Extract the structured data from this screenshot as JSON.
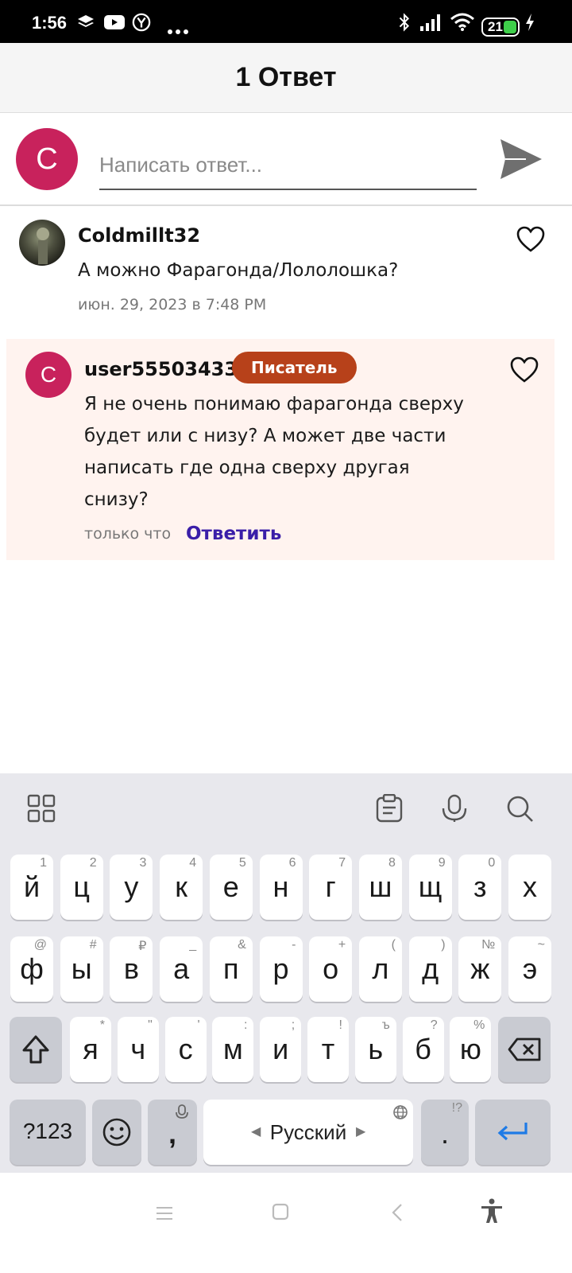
{
  "status_bar": {
    "time": "1:56",
    "battery": "21"
  },
  "header": {
    "title": "1 Ответ"
  },
  "compose": {
    "avatar_letter": "C",
    "placeholder": "Написать ответ..."
  },
  "comments": [
    {
      "username": "Coldmillt32",
      "text": "А можно Фарагонда/Лололошка?",
      "date": "июн. 29, 2023 в 7:48 PM"
    },
    {
      "avatar_letter": "C",
      "username": "user55503433",
      "badge": "Писатель",
      "text_lines": [
        "Я не очень понимаю фарагонда сверху",
        "будет или с низу? А может две части",
        "написать где одна сверху другая",
        "снизу?"
      ],
      "date": "только что",
      "reply_label": "Ответить"
    }
  ],
  "keyboard": {
    "row1": [
      {
        "k": "й",
        "h": "1"
      },
      {
        "k": "ц",
        "h": "2"
      },
      {
        "k": "у",
        "h": "3"
      },
      {
        "k": "к",
        "h": "4"
      },
      {
        "k": "е",
        "h": "5"
      },
      {
        "k": "н",
        "h": "6"
      },
      {
        "k": "г",
        "h": "7"
      },
      {
        "k": "ш",
        "h": "8"
      },
      {
        "k": "щ",
        "h": "9"
      },
      {
        "k": "з",
        "h": "0"
      },
      {
        "k": "х",
        "h": ""
      }
    ],
    "row2": [
      {
        "k": "ф",
        "h": "@"
      },
      {
        "k": "ы",
        "h": "#"
      },
      {
        "k": "в",
        "h": "₽"
      },
      {
        "k": "а",
        "h": "_"
      },
      {
        "k": "п",
        "h": "&"
      },
      {
        "k": "р",
        "h": "-"
      },
      {
        "k": "о",
        "h": "+"
      },
      {
        "k": "л",
        "h": "("
      },
      {
        "k": "д",
        "h": ")"
      },
      {
        "k": "ж",
        "h": "№"
      },
      {
        "k": "э",
        "h": "~"
      }
    ],
    "row3": [
      {
        "k": "я",
        "h": "*"
      },
      {
        "k": "ч",
        "h": "\""
      },
      {
        "k": "с",
        "h": "'"
      },
      {
        "k": "м",
        "h": ":"
      },
      {
        "k": "и",
        "h": ";"
      },
      {
        "k": "т",
        "h": "!"
      },
      {
        "k": "ь",
        "h": "ъ"
      },
      {
        "k": "б",
        "h": "?"
      },
      {
        "k": "ю",
        "h": "%"
      }
    ],
    "symbols_label": "?123",
    "comma_label": ",",
    "space_label": "Русский",
    "period_label": ".",
    "period_hint": "!?"
  }
}
